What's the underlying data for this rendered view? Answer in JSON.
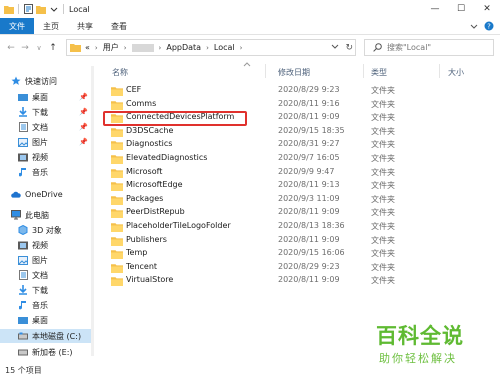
{
  "window": {
    "title": "Local",
    "controls": {
      "minimize": "—",
      "maximize": "☐",
      "close": "✕"
    }
  },
  "ribbon": {
    "tabs": [
      "文件",
      "主页",
      "共享",
      "查看"
    ]
  },
  "address": {
    "back": "←",
    "forward": "→",
    "recent": "∨",
    "up": "↑",
    "crumbs": [
      "«",
      "用户",
      "AppData",
      "Local"
    ],
    "refresh": "↻",
    "search_placeholder": "搜索\"Local\""
  },
  "columns": {
    "name": "名称",
    "date": "修改日期",
    "type": "类型",
    "size": "大小"
  },
  "files": [
    {
      "name": "CEF",
      "date": "2020/8/29 9:23",
      "type": "文件夹"
    },
    {
      "name": "Comms",
      "date": "2020/8/11 9:16",
      "type": "文件夹"
    },
    {
      "name": "ConnectedDevicesPlatform",
      "date": "2020/8/11 9:09",
      "type": "文件夹"
    },
    {
      "name": "D3DSCache",
      "date": "2020/9/15 18:35",
      "type": "文件夹"
    },
    {
      "name": "Diagnostics",
      "date": "2020/8/31 9:27",
      "type": "文件夹"
    },
    {
      "name": "ElevatedDiagnostics",
      "date": "2020/9/7 16:05",
      "type": "文件夹"
    },
    {
      "name": "Microsoft",
      "date": "2020/9/9 9:47",
      "type": "文件夹"
    },
    {
      "name": "MicrosoftEdge",
      "date": "2020/8/11 9:13",
      "type": "文件夹"
    },
    {
      "name": "Packages",
      "date": "2020/9/3 11:09",
      "type": "文件夹"
    },
    {
      "name": "PeerDistRepub",
      "date": "2020/8/11 9:09",
      "type": "文件夹"
    },
    {
      "name": "PlaceholderTileLogoFolder",
      "date": "2020/8/13 18:36",
      "type": "文件夹"
    },
    {
      "name": "Publishers",
      "date": "2020/8/11 9:09",
      "type": "文件夹"
    },
    {
      "name": "Temp",
      "date": "2020/9/15 16:06",
      "type": "文件夹"
    },
    {
      "name": "Tencent",
      "date": "2020/8/29 9:23",
      "type": "文件夹"
    },
    {
      "name": "VirtualStore",
      "date": "2020/8/11 9:09",
      "type": "文件夹"
    }
  ],
  "sidebar": {
    "items": [
      {
        "label": "快速访问",
        "icon": "star-icon"
      },
      {
        "label": "桌面",
        "icon": "desktop-icon"
      },
      {
        "label": "下载",
        "icon": "download-icon"
      },
      {
        "label": "文档",
        "icon": "document-icon"
      },
      {
        "label": "图片",
        "icon": "picture-icon"
      },
      {
        "label": "视频",
        "icon": "video-icon"
      },
      {
        "label": "音乐",
        "icon": "music-icon"
      },
      {
        "label": "OneDrive",
        "icon": "cloud-icon"
      },
      {
        "label": "此电脑",
        "icon": "computer-icon"
      },
      {
        "label": "3D 对象",
        "icon": "cube-icon"
      },
      {
        "label": "视频",
        "icon": "video-icon"
      },
      {
        "label": "图片",
        "icon": "picture-icon"
      },
      {
        "label": "文档",
        "icon": "document-icon"
      },
      {
        "label": "下载",
        "icon": "download-icon"
      },
      {
        "label": "音乐",
        "icon": "music-icon"
      },
      {
        "label": "桌面",
        "icon": "desktop-icon"
      },
      {
        "label": "本地磁盘 (C:)",
        "icon": "drive-icon"
      },
      {
        "label": "新加卷 (E:)",
        "icon": "drive-icon"
      }
    ]
  },
  "status": {
    "count": "15 个项目"
  },
  "watermark": {
    "title": "百科全说",
    "subtitle": "助你轻松解决"
  },
  "colors": {
    "accent": "#1979ca",
    "folder": "#f5c04a",
    "highlight": "#e0312d",
    "selection": "#cce4f7"
  }
}
